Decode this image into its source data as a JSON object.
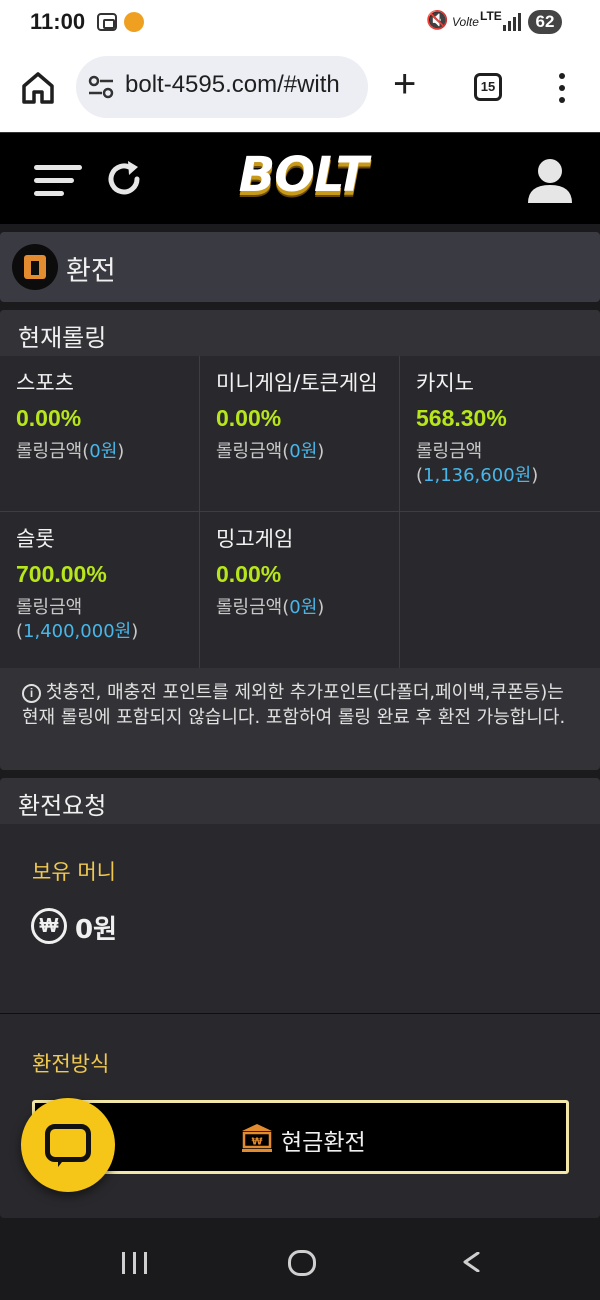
{
  "status": {
    "time": "11:00",
    "battery": "62",
    "volte": "Volte",
    "lte": "LTE"
  },
  "browser": {
    "url": "bolt-4595.com/#with",
    "tab_count": "15"
  },
  "site": {
    "logo": "BOLT"
  },
  "page": {
    "title": "환전"
  },
  "rolling": {
    "header": "현재롤링",
    "amount_label": "롤링금액",
    "items": [
      {
        "name": "스포츠",
        "pct": "0.00%",
        "amount": "0원"
      },
      {
        "name": "미니게임/토큰게임",
        "pct": "0.00%",
        "amount": "0원"
      },
      {
        "name": "카지노",
        "pct": "568.30%",
        "amount": "1,136,600원"
      },
      {
        "name": "슬롯",
        "pct": "700.00%",
        "amount": "1,400,000원"
      },
      {
        "name": "밍고게임",
        "pct": "0.00%",
        "amount": "0원"
      }
    ],
    "notice": "첫충전, 매충전 포인트를 제외한 추가포인트(다폴더,페이백,쿠폰등)는 현재 롤링에 포함되지 않습니다. 포함하여 롤링 완료 후 환전 가능합니다."
  },
  "exchange": {
    "header": "환전요청",
    "money_label": "보유 머니",
    "won_symbol": "₩",
    "money_value": "0원",
    "method_label": "환전방식",
    "cash_button": "현금환전"
  },
  "colors": {
    "accent_green": "#b7e61b",
    "accent_yellow": "#f0c850",
    "link_blue": "#48b6e8",
    "chat_yellow": "#f5c518"
  }
}
